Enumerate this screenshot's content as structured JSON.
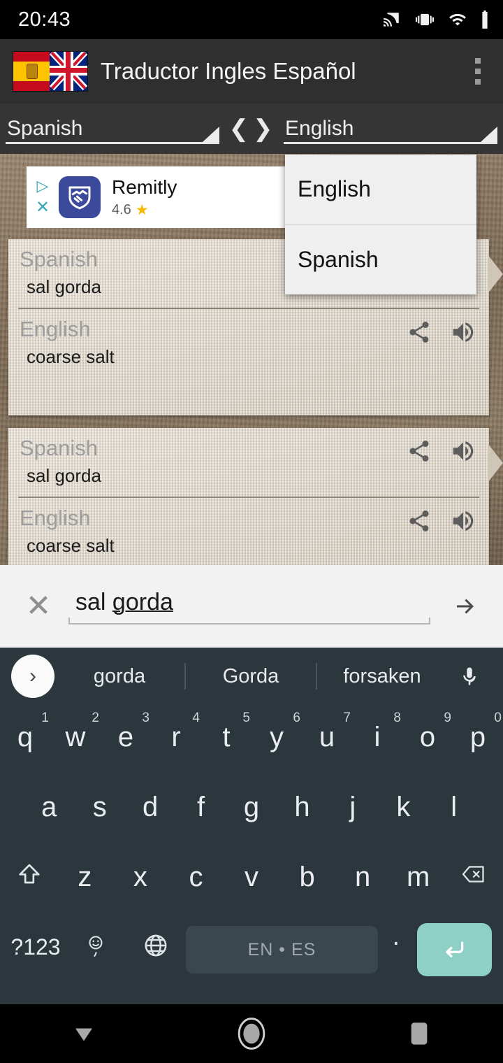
{
  "status_bar": {
    "time": "20:43",
    "icons": [
      "cast-icon",
      "vibrate-icon",
      "wifi-icon",
      "battery-icon"
    ]
  },
  "app_bar": {
    "title": "Traductor Ingles Español",
    "flag_icon": "spain-uk-flag-icon",
    "overflow_icon": "overflow-menu-icon"
  },
  "language_bar": {
    "source": "Spanish",
    "target": "English",
    "swap_left": "❮",
    "swap_right": "❯"
  },
  "dropdown": {
    "open": true,
    "options": [
      "English",
      "Spanish"
    ]
  },
  "ad": {
    "title": "Remitly",
    "rating": "4.6",
    "star": "★",
    "adchoices_icon": "adchoices-icon",
    "close_icon": "close-icon",
    "logo_icon": "remitly-handshake-icon"
  },
  "cards": [
    {
      "source_lang": "Spanish",
      "source_text": "sal gorda",
      "target_lang": "English",
      "target_text": "coarse salt",
      "source_icons": [
        "share-icon",
        "speaker-icon"
      ],
      "target_icons": [
        "share-icon",
        "speaker-icon"
      ]
    },
    {
      "source_lang": "Spanish",
      "source_text": "sal gorda",
      "target_lang": "English",
      "target_text": "coarse salt",
      "source_icons": [
        "share-icon",
        "speaker-icon"
      ],
      "target_icons": [
        "share-icon",
        "speaker-icon"
      ]
    }
  ],
  "input_bar": {
    "clear_glyph": "✕",
    "text_plain": "sal ",
    "text_underlined": "gorda",
    "full_value": "sal gorda",
    "placeholder": "",
    "submit_icon": "arrow-right-icon"
  },
  "keyboard": {
    "suggestions": [
      "gorda",
      "Gorda",
      "forsaken"
    ],
    "expand_glyph": "›",
    "mic_icon": "microphone-icon",
    "row1": [
      {
        "k": "q",
        "hint": "1"
      },
      {
        "k": "w",
        "hint": "2"
      },
      {
        "k": "e",
        "hint": "3"
      },
      {
        "k": "r",
        "hint": "4"
      },
      {
        "k": "t",
        "hint": "5"
      },
      {
        "k": "y",
        "hint": "6"
      },
      {
        "k": "u",
        "hint": "7"
      },
      {
        "k": "i",
        "hint": "8"
      },
      {
        "k": "o",
        "hint": "9"
      },
      {
        "k": "p",
        "hint": "0"
      }
    ],
    "row2": [
      "a",
      "s",
      "d",
      "f",
      "g",
      "h",
      "j",
      "k",
      "l"
    ],
    "row3": [
      "z",
      "x",
      "c",
      "v",
      "b",
      "n",
      "m"
    ],
    "shift_icon": "shift-icon",
    "backspace_icon": "backspace-icon",
    "symbols_label": "?123",
    "emoji_icon": "emoji-comma-icon",
    "globe_icon": "language-globe-icon",
    "spacebar_label": "EN • ES",
    "period_label": ".",
    "enter_icon": "enter-icon"
  },
  "nav_bar": {
    "back_icon": "back-down-triangle-icon",
    "home_icon": "home-circle-icon",
    "recents_icon": "recents-square-icon"
  },
  "colors": {
    "status_bar": "#000000",
    "app_bar": "#2f2f2f",
    "language_bar": "#353535",
    "card": "#d8d0c4",
    "background": "#8c7860",
    "keyboard": "#2b363d",
    "enter_key": "#8ecfc6",
    "ad_logo": "#3c4a9b",
    "star": "#f6b800"
  }
}
